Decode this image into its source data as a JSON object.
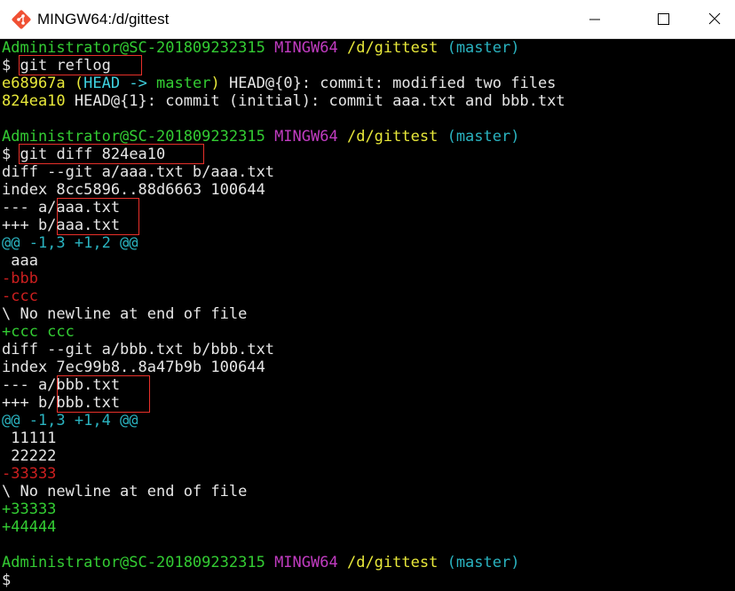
{
  "window": {
    "title": "MINGW64:/d/gittest",
    "controls": {
      "minimize": "minimize-icon",
      "maximize": "maximize-icon",
      "close": "close-icon"
    },
    "icon": "git-bash-icon"
  },
  "colors": {
    "prompt_user": "#33cc33",
    "prompt_shell": "#c13cc1",
    "prompt_path": "#e8e83a",
    "prompt_branch": "#2ab3c0",
    "diff_removed": "#cc1f1f",
    "diff_added": "#33cc33",
    "hunk": "#2ab3c0",
    "text": "#d3d7cf",
    "highlight_box": "#e8302a"
  },
  "prompt": {
    "user": "Administrator@SC-201809232315",
    "shell": "MINGW64",
    "path": "/d/gittest",
    "branch": "(master)",
    "symbol": "$"
  },
  "commands": {
    "reflog": "git reflog",
    "diff": "git diff 824ea10"
  },
  "reflog": {
    "line1": {
      "hash": "e68967a",
      "head_open": "(",
      "head": "HEAD ->",
      "branch": " master",
      "head_close": ")",
      "rest": " HEAD@{0}: commit: modified two files"
    },
    "line2": {
      "hash": "824ea10",
      "rest": " HEAD@{1}: commit (initial): commit aaa.txt and bbb.txt"
    }
  },
  "diff": {
    "file1": {
      "header": "diff --git a/aaa.txt b/aaa.txt",
      "index": "index 8cc5896..88d6663 100644",
      "minus_prefix": "--- a/",
      "minus_file": "aaa.txt",
      "plus_prefix": "+++ b/",
      "plus_file": "aaa.txt",
      "hunk": "@@ -1,3 +1,2 @@",
      "lines": [
        {
          "type": "context",
          "text": " aaa"
        },
        {
          "type": "removed",
          "text": "-bbb"
        },
        {
          "type": "removed",
          "text": "-ccc"
        },
        {
          "type": "note",
          "text": "\\ No newline at end of file"
        },
        {
          "type": "added",
          "text": "+ccc ccc"
        }
      ]
    },
    "file2": {
      "header": "diff --git a/bbb.txt b/bbb.txt",
      "index": "index 7ec99b8..8a47b9b 100644",
      "minus_prefix": "--- a/",
      "minus_file": "bbb.txt",
      "plus_prefix": "+++ b/",
      "plus_file": "bbb.txt",
      "hunk": "@@ -1,3 +1,4 @@",
      "lines": [
        {
          "type": "context",
          "text": " 11111"
        },
        {
          "type": "context",
          "text": " 22222"
        },
        {
          "type": "removed",
          "text": "-33333"
        },
        {
          "type": "note",
          "text": "\\ No newline at end of file"
        },
        {
          "type": "added",
          "text": "+33333"
        },
        {
          "type": "added",
          "text": "+44444"
        }
      ]
    }
  }
}
